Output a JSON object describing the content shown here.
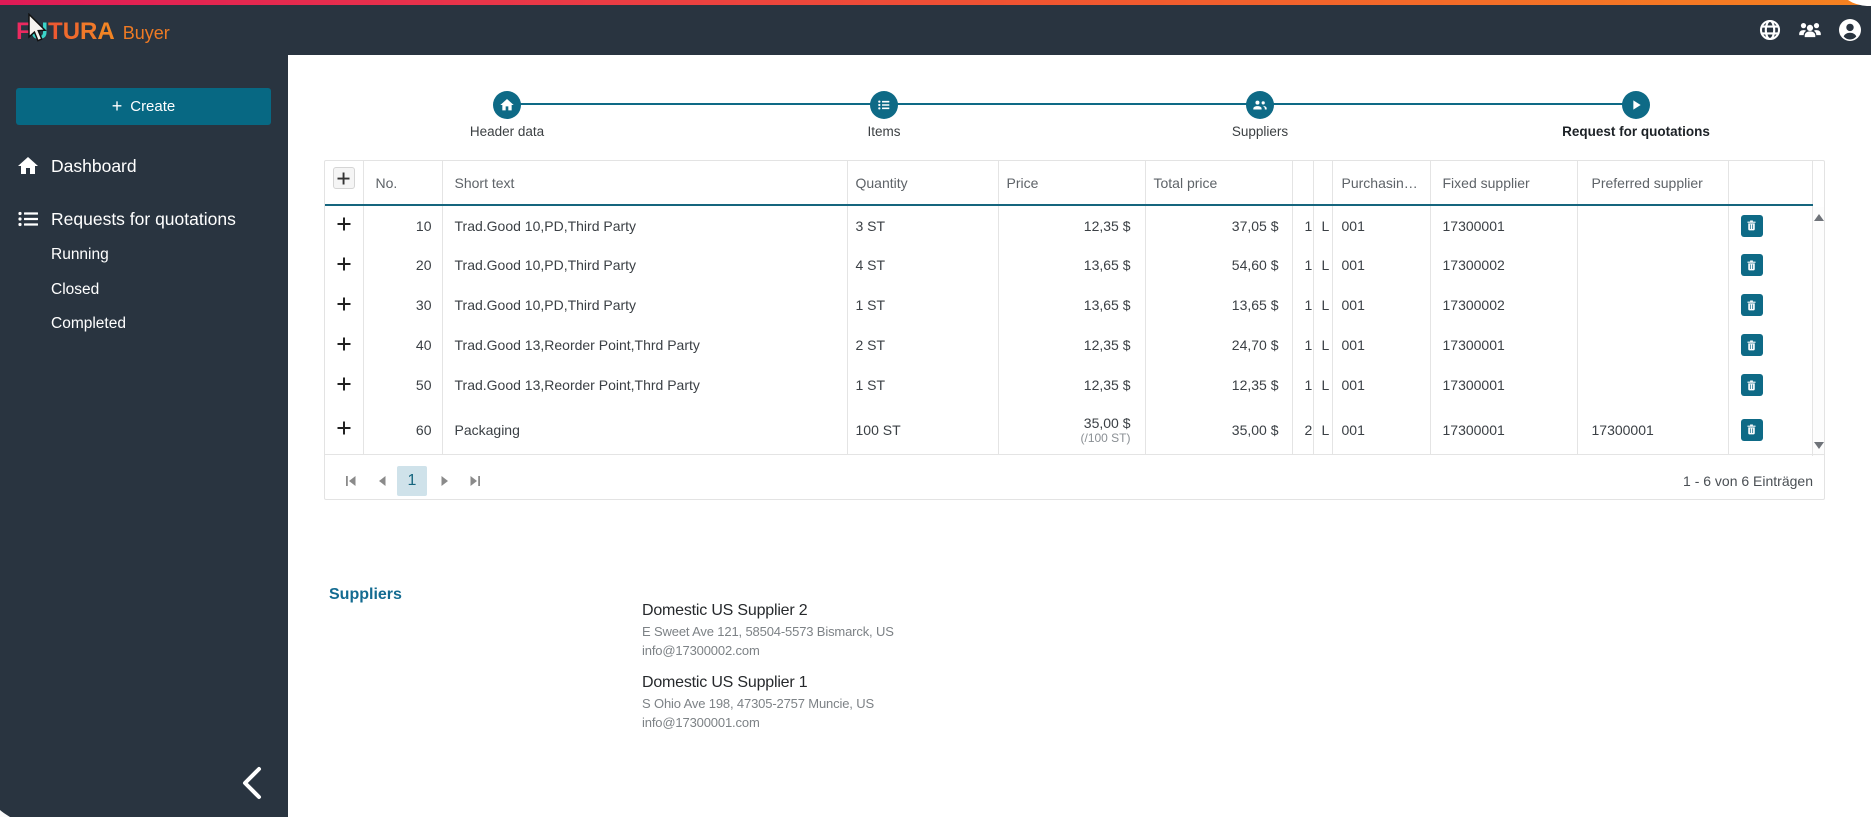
{
  "topbar": {
    "brand_primary": "FUTURA",
    "brand_secondary": "Buyer",
    "icons": [
      "globe-icon",
      "users-icon",
      "account-icon"
    ]
  },
  "sidebar": {
    "create_label": "Create",
    "items": [
      {
        "label": "Dashboard",
        "icon": "home"
      },
      {
        "label": "Requests for quotations",
        "icon": "list"
      }
    ],
    "subitems": [
      {
        "label": "Running"
      },
      {
        "label": "Closed"
      },
      {
        "label": "Completed"
      }
    ]
  },
  "stepper": {
    "steps": [
      {
        "label": "Header data",
        "icon": "home",
        "active": false
      },
      {
        "label": "Items",
        "icon": "list",
        "active": false
      },
      {
        "label": "Suppliers",
        "icon": "people",
        "active": false
      },
      {
        "label": "Request for quotations",
        "icon": "play",
        "active": true
      }
    ]
  },
  "grid": {
    "columns": [
      "",
      "No.",
      "Short text",
      "Quantity",
      "Price",
      "Total price",
      "",
      "",
      "Purchasin…",
      "Fixed supplier",
      "Preferred supplier",
      ""
    ],
    "rows": [
      {
        "no": "10",
        "short_text": "Trad.Good 10,PD,Third Party",
        "quantity": "3 ST",
        "price": "12,35 $",
        "price_note": "",
        "total": "37,05 $",
        "n1": "1",
        "n2": "L",
        "purchasing": "001",
        "fixed_supplier": "17300001",
        "preferred_supplier": ""
      },
      {
        "no": "20",
        "short_text": "Trad.Good 10,PD,Third Party",
        "quantity": "4 ST",
        "price": "13,65 $",
        "price_note": "",
        "total": "54,60 $",
        "n1": "1",
        "n2": "L",
        "purchasing": "001",
        "fixed_supplier": "17300002",
        "preferred_supplier": ""
      },
      {
        "no": "30",
        "short_text": "Trad.Good 10,PD,Third Party",
        "quantity": "1 ST",
        "price": "13,65 $",
        "price_note": "",
        "total": "13,65 $",
        "n1": "1",
        "n2": "L",
        "purchasing": "001",
        "fixed_supplier": "17300002",
        "preferred_supplier": ""
      },
      {
        "no": "40",
        "short_text": "Trad.Good 13,Reorder Point,Thrd Party",
        "quantity": "2 ST",
        "price": "12,35 $",
        "price_note": "",
        "total": "24,70 $",
        "n1": "1",
        "n2": "L",
        "purchasing": "001",
        "fixed_supplier": "17300001",
        "preferred_supplier": ""
      },
      {
        "no": "50",
        "short_text": "Trad.Good 13,Reorder Point,Thrd Party",
        "quantity": "1 ST",
        "price": "12,35 $",
        "price_note": "",
        "total": "12,35 $",
        "n1": "1",
        "n2": "L",
        "purchasing": "001",
        "fixed_supplier": "17300001",
        "preferred_supplier": ""
      },
      {
        "no": "60",
        "short_text": "Packaging",
        "quantity": "100 ST",
        "price": "35,00 $",
        "price_note": "(/100 ST)",
        "total": "35,00 $",
        "n1": "2",
        "n2": "L",
        "purchasing": "001",
        "fixed_supplier": "17300001",
        "preferred_supplier": "17300001"
      }
    ],
    "pagination": {
      "page": "1",
      "info": "1 - 6 von 6 Einträgen"
    }
  },
  "suppliers": {
    "title": "Suppliers",
    "entries": [
      {
        "name": "Domestic US Supplier 2",
        "address": "E Sweet Ave 121, 58504-5573 Bismarck, US",
        "email": "info@17300002.com"
      },
      {
        "name": "Domestic US Supplier 1",
        "address": "S Ohio Ave 198, 47305-2757 Muncie, US",
        "email": "info@17300001.com"
      }
    ]
  },
  "colors": {
    "accent_teal": "#0e6a86",
    "dark_bar": "#293440",
    "gradient_left": "#df1a56",
    "gradient_right": "#f58220"
  }
}
